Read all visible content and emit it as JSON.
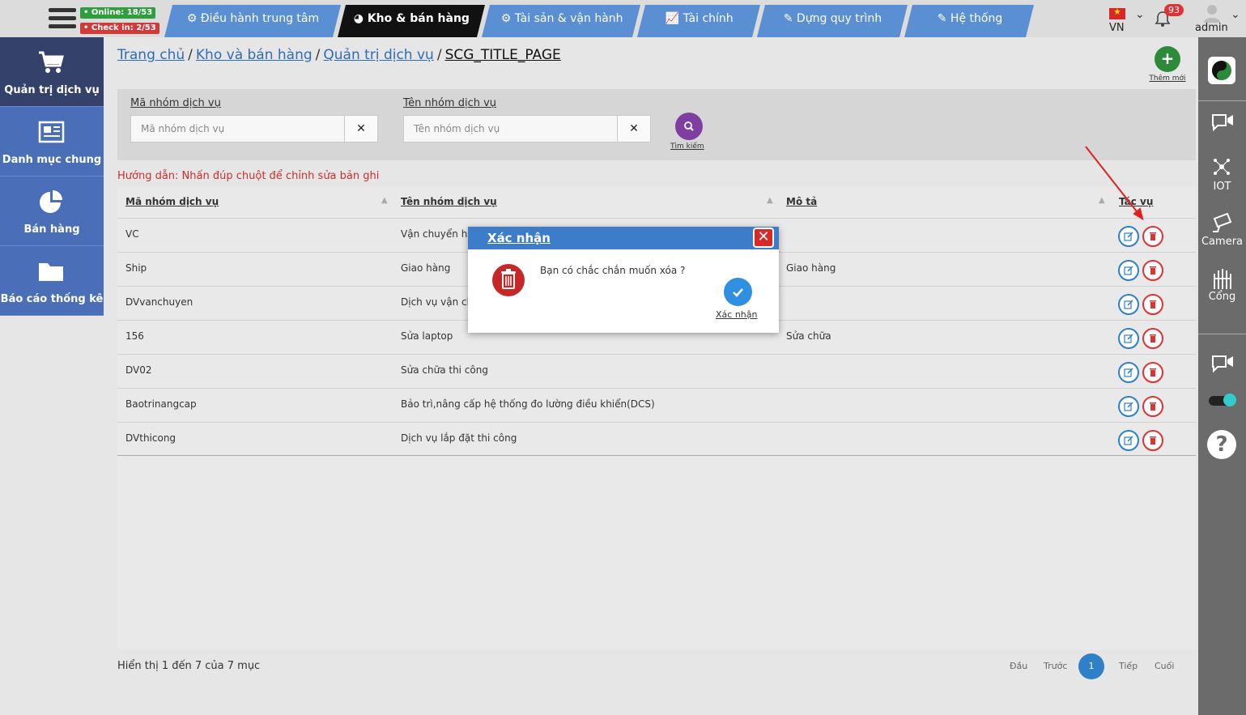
{
  "topbar": {
    "online": "• Online: 18/53",
    "checkin": "• Check in: 2/53",
    "tabs": [
      {
        "label": "⚙ Điều hành trung tâm"
      },
      {
        "label": "◕ Kho & bán hàng"
      },
      {
        "label": "⚙ Tài sản & vận hành"
      },
      {
        "label": "📈 Tài chính"
      },
      {
        "label": "✎ Dựng quy trình"
      },
      {
        "label": "✎ Hệ thống"
      }
    ],
    "language": "VN",
    "notifications": "93",
    "user": "admin"
  },
  "leftnav": [
    {
      "label": "Quản trị dịch vụ",
      "icon": "cart-icon"
    },
    {
      "label": "Danh mục chung",
      "icon": "newspaper-icon"
    },
    {
      "label": "Bán hàng",
      "icon": "pie-chart-icon"
    },
    {
      "label": "Báo cáo thống kê",
      "icon": "folder-icon"
    }
  ],
  "rightbar": {
    "iot": "IOT",
    "camera": "Camera",
    "gate": "Cổng"
  },
  "breadcrumb": {
    "home": "Trang chủ",
    "section": "Kho và bán hàng",
    "page": "Quản trị dịch vụ",
    "current": "SCG_TITLE_PAGE"
  },
  "add_new": "Thêm mới",
  "filter": {
    "code_label": "Mã nhóm dịch vụ",
    "code_placeholder": "Mã nhóm dịch vụ",
    "name_label": "Tên nhóm dịch vụ",
    "name_placeholder": "Tên nhóm dịch vụ",
    "search_label": "Tìm kiếm"
  },
  "hint": "Hướng dẫn: Nhấn đúp chuột để chỉnh sửa bản ghi",
  "table": {
    "headers": [
      "Mã nhóm dịch vụ",
      "Tên nhóm dịch vụ",
      "Mô tả",
      "Tác vụ"
    ],
    "rows": [
      {
        "code": "VC",
        "name": "Vận chuyển hà",
        "desc": ""
      },
      {
        "code": "Ship",
        "name": "Giao hàng",
        "desc": "Giao hàng"
      },
      {
        "code": "DVvanchuyen",
        "name": "Dịch vụ vận ch",
        "desc": ""
      },
      {
        "code": "156",
        "name": "Sửa laptop",
        "desc": "Sửa chữa"
      },
      {
        "code": "DV02",
        "name": "Sửa chữa thi công",
        "desc": ""
      },
      {
        "code": "Baotrinangcap",
        "name": "Bảo trì,nâng cấp hệ thống đo lường điều khiển(DCS)",
        "desc": ""
      },
      {
        "code": "DVthicong",
        "name": "Dịch vụ lắp đặt thi công",
        "desc": ""
      }
    ]
  },
  "footer": {
    "info": "Hiển thị 1 đến 7 của 7 mục",
    "first": "Đầu",
    "prev": "Trước",
    "current_page": "1",
    "next": "Tiếp",
    "last": "Cuối"
  },
  "modal": {
    "title": "Xác nhận",
    "message": "Bạn có chắc chắn muốn xóa ?",
    "confirm_label": "Xác nhận"
  },
  "colors": {
    "accent": "#4a6fb8",
    "danger": "#d33333",
    "modal_header": "#3d7cc9"
  }
}
